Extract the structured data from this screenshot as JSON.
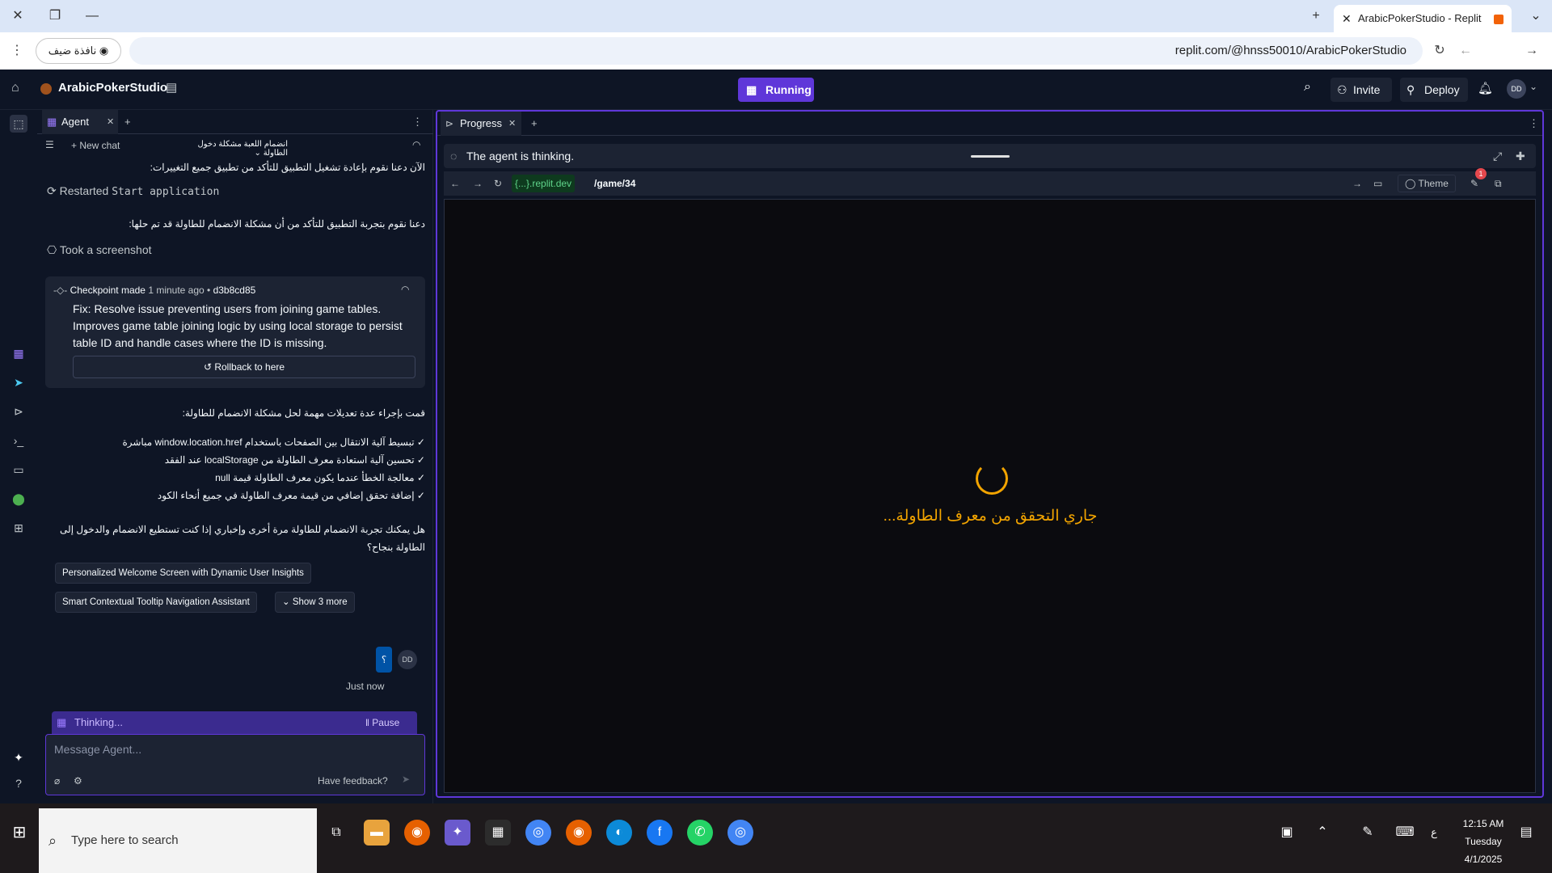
{
  "browser": {
    "tab_title": "ArabicPokerStudio - Replit",
    "guest_label": "نافذة ضيف",
    "url": "replit.com/@hnss50010/ArabicPokerStudio"
  },
  "header": {
    "app_name": "ArabicPokerStudio",
    "run_label": "Running",
    "invite_label": "Invite",
    "deploy_label": "Deploy",
    "avatar_initials": "DD"
  },
  "agent": {
    "tab_label": "Agent",
    "new_chat": "New chat",
    "chat_title": "انضمام اللعبة مشكلة دخول الطاولة",
    "msg1": "الآن دعنا نقوم بإعادة تشغيل التطبيق للتأكد من تطبيق جميع التغييرات:",
    "restarted_prefix": "Restarted",
    "restarted_cmd": "Start application",
    "msg2": "دعنا نقوم بتجربة التطبيق للتأكد من أن مشكلة الانضمام للطاولة قد تم حلها:",
    "screenshot": "Took a screenshot",
    "checkpoint": {
      "label": "Checkpoint made",
      "time": "1 minute ago",
      "hash": "d3b8cd85",
      "text": "Fix: Resolve issue preventing users from joining game tables. Improves game table joining logic by using local storage to persist table ID and handle cases where the ID is missing.",
      "rollback": "Rollback to here"
    },
    "summary_title": "قمت بإجراء عدة تعديلات مهمة لحل مشكلة الانضمام للطاولة:",
    "bullets": [
      "✓ تبسيط آلية الانتقال بين الصفحات باستخدام window.location.href مباشرة",
      "✓ تحسين آلية استعادة معرف الطاولة من localStorage عند الفقد",
      "✓ معالجة الخطأ عندما يكون معرف الطاولة قيمة null",
      "✓ إضافة تحقق إضافي من قيمة معرف الطاولة في جميع أنحاء الكود"
    ],
    "question": "هل يمكنك تجربة الانضمام للطاولة مرة أخرى وإخباري إذا كنت تستطيع الانضمام والدخول إلى الطاولة بنجاح؟",
    "chips": [
      "Personalized Welcome Screen with Dynamic User Insights",
      "Smart Contextual Tooltip Navigation Assistant"
    ],
    "show_more": "Show 3 more",
    "user_msg": "؟",
    "user_avatar": "DD",
    "user_time": "Just now",
    "thinking": "Thinking...",
    "pause": "Pause",
    "input_placeholder": "Message Agent...",
    "feedback": "Have feedback?"
  },
  "progress": {
    "tab_label": "Progress",
    "status": "The agent is thinking.",
    "domain": "{...}.replit.dev",
    "path": "/game/34",
    "theme": "Theme",
    "badge": "1",
    "loading_text": "جاري التحقق من معرف الطاولة..."
  },
  "taskbar": {
    "search_placeholder": "Type here to search",
    "time": "12:15 AM",
    "day": "Tuesday",
    "date": "4/1/2025",
    "lang": "ع"
  }
}
